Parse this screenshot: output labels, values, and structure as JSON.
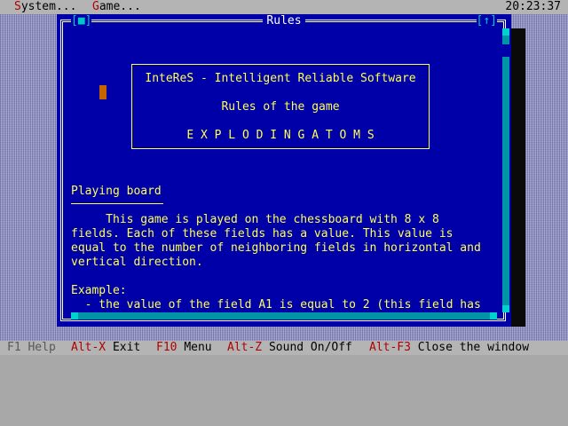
{
  "menubar": {
    "items": [
      {
        "hot": "S",
        "rest": "ystem..."
      },
      {
        "hot": "G",
        "rest": "ame..."
      }
    ],
    "clock": "20:23:37"
  },
  "window": {
    "title": "Rules",
    "close_box": "[■]",
    "zoom_box": "[↑]"
  },
  "banner": {
    "line1": "InteReS - Intelligent Reliable Software",
    "line2": "Rules of the game",
    "line3": "E X P L O D I N G   A T O M S"
  },
  "content": {
    "heading": "Playing board",
    "lines": [
      "     This game is played on the chessboard with 8 x 8",
      "fields. Each of these fields has a value. This value is",
      "equal to the number of neighboring fields in horizontal and",
      "vertical direction.",
      "",
      "Example:",
      "  - the value of the field A1 is equal to 2 (this field has"
    ]
  },
  "statusbar": {
    "help": {
      "key": "F1",
      "label": "Help"
    },
    "items": [
      {
        "key": "Alt-X",
        "label": "Exit"
      },
      {
        "key": "F10",
        "label": "Menu"
      },
      {
        "key": "Alt-Z",
        "label": "Sound On/Off"
      },
      {
        "key": "Alt-F3",
        "label": "Close the window"
      }
    ]
  },
  "colors": {
    "window_bg": "#0000a8",
    "text": "#ffff55",
    "frame": "#ffffff",
    "scrollbar": "#0094a8",
    "hotkey": "#b00000"
  }
}
